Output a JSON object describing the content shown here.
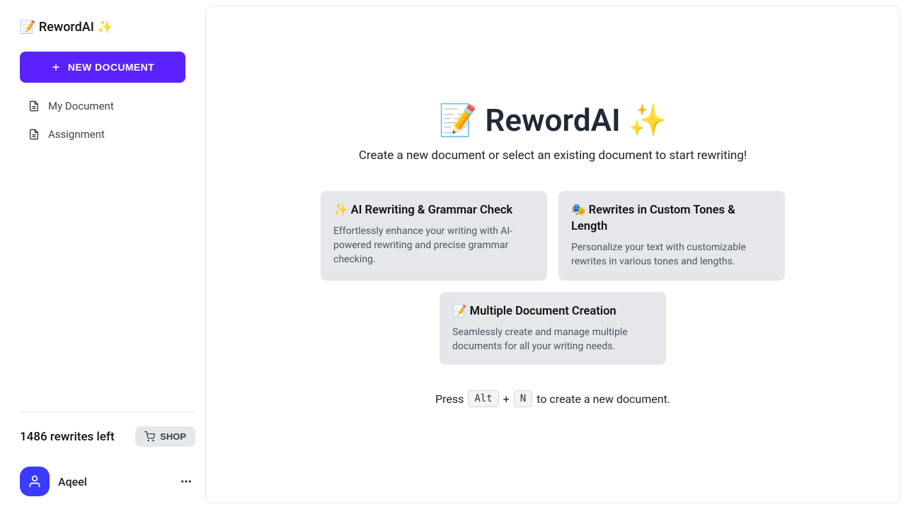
{
  "brand": "📝 RewordAI ✨",
  "newDocLabel": "NEW DOCUMENT",
  "docItems": [
    {
      "label": "My Document"
    },
    {
      "label": "Assignment"
    }
  ],
  "rewritesLeft": "1486 rewrites left",
  "shopLabel": "SHOP",
  "userName": "Aqeel",
  "hero": {
    "title": "📝 RewordAI ✨",
    "subtitle": "Create a new document or select an existing document to start rewriting!"
  },
  "cards": [
    {
      "title": "✨ AI Rewriting & Grammar Check",
      "desc": "Effortlessly enhance your writing with AI-powered rewriting and precise grammar checking."
    },
    {
      "title": "🎭 Rewrites in Custom Tones & Length",
      "desc": "Personalize your text with customizable rewrites in various tones and lengths."
    },
    {
      "title": "📝 Multiple Document Creation",
      "desc": "Seamlessly create and manage multiple documents for all your writing needs."
    }
  ],
  "kbd": {
    "before": "Press",
    "key1": "Alt",
    "plus": "+",
    "key2": "N",
    "after": "to create a new document."
  }
}
